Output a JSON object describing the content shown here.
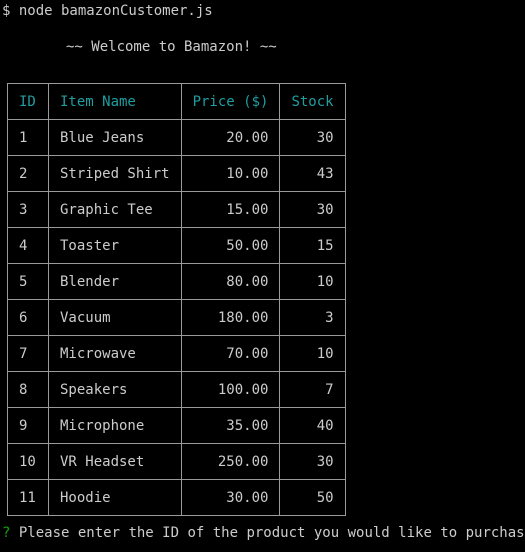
{
  "terminal": {
    "command_prompt": "$ node bamazonCustomer.js",
    "welcome": "~~ Welcome to Bamazon! ~~",
    "question_mark": "?",
    "question": " Please enter the ID of the product you would like to purchase:"
  },
  "colors": {
    "background": "#000000",
    "text": "#cccccc",
    "header": "#1f9ea0",
    "prompt_marker": "#13a10e",
    "border": "#9a9a9a"
  },
  "table": {
    "headers": [
      "ID",
      "Item Name",
      "Price ($)",
      "Stock"
    ],
    "rows": [
      {
        "id": "1",
        "name": "Blue Jeans",
        "price": "20.00",
        "stock": "30"
      },
      {
        "id": "2",
        "name": "Striped Shirt",
        "price": "10.00",
        "stock": "43"
      },
      {
        "id": "3",
        "name": "Graphic Tee",
        "price": "15.00",
        "stock": "30"
      },
      {
        "id": "4",
        "name": "Toaster",
        "price": "50.00",
        "stock": "15"
      },
      {
        "id": "5",
        "name": "Blender",
        "price": "80.00",
        "stock": "10"
      },
      {
        "id": "6",
        "name": "Vacuum",
        "price": "180.00",
        "stock": "3"
      },
      {
        "id": "7",
        "name": "Microwave",
        "price": "70.00",
        "stock": "10"
      },
      {
        "id": "8",
        "name": "Speakers",
        "price": "100.00",
        "stock": "7"
      },
      {
        "id": "9",
        "name": "Microphone",
        "price": "35.00",
        "stock": "40"
      },
      {
        "id": "10",
        "name": "VR Headset",
        "price": "250.00",
        "stock": "30"
      },
      {
        "id": "11",
        "name": "Hoodie",
        "price": "30.00",
        "stock": "50"
      }
    ]
  }
}
